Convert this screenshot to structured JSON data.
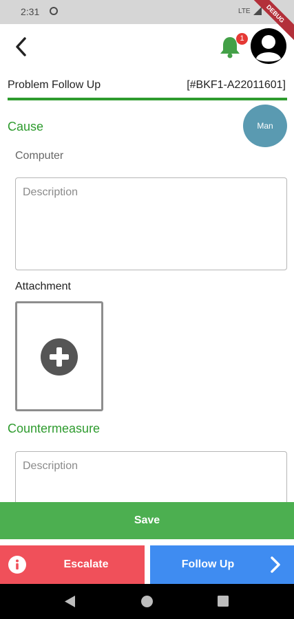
{
  "status_bar": {
    "time": "2:31",
    "network": "LTE",
    "debug_banner": "DEBUG"
  },
  "header": {
    "notification_count": "1",
    "colors": {
      "bell": "#43a047",
      "badge": "#e53935"
    }
  },
  "page": {
    "title": "Problem Follow Up",
    "code": "[#BKF1-A22011601]",
    "accent_color": "#2e9b2e"
  },
  "cause": {
    "heading": "Cause",
    "category_chip": "Man",
    "item_label": "Computer",
    "description_placeholder": "Description",
    "description_value": "",
    "attachment_label": "Attachment"
  },
  "countermeasure": {
    "heading": "Countermeasure",
    "description_placeholder": "Description",
    "description_value": ""
  },
  "actions": {
    "save_label": "Save",
    "escalate_label": "Escalate",
    "follow_up_label": "Follow Up",
    "colors": {
      "save": "#4caf50",
      "escalate": "#f0505a",
      "follow_up": "#3f8cf1"
    }
  },
  "icons": {
    "back": "chevron-left-icon",
    "notifications": "bell-icon",
    "avatar": "user-avatar-icon",
    "add_attachment": "plus-circle-icon",
    "escalate": "info-icon",
    "follow_up": "chevron-right-icon"
  }
}
